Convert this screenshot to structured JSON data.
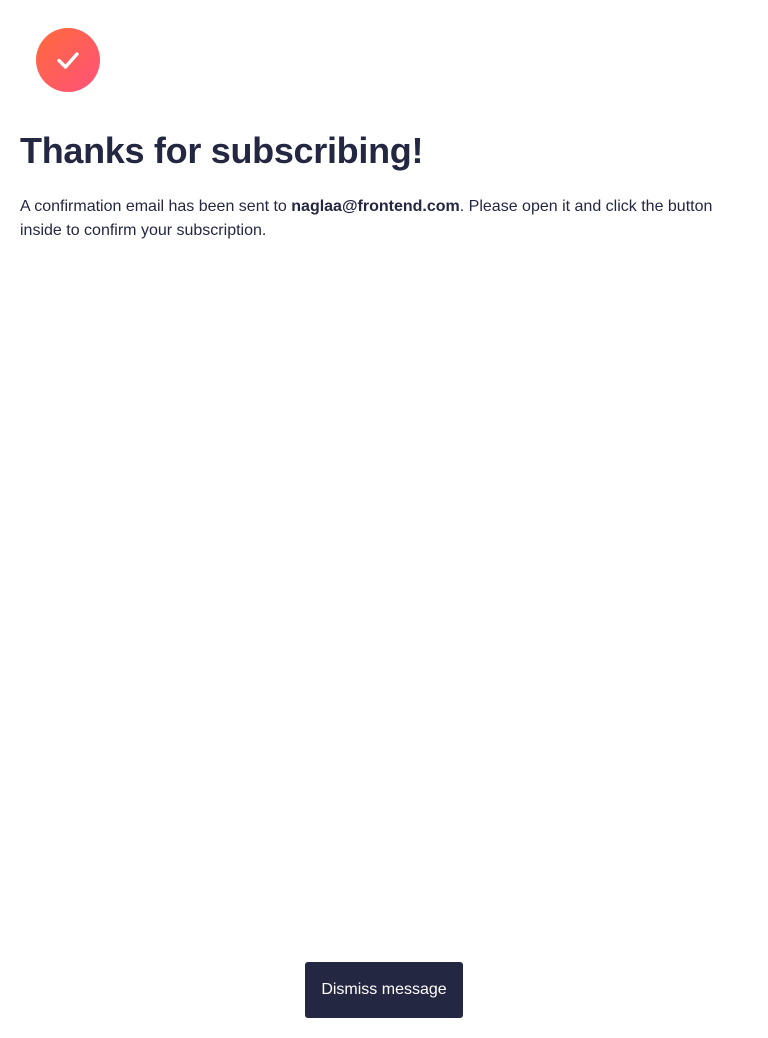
{
  "icon": {
    "name": "checkmark-icon",
    "gradient_start": "#ff6a3a",
    "gradient_end": "#ff527b",
    "check_color": "#ffffff"
  },
  "title": "Thanks for subscribing!",
  "message": {
    "prefix": "A confirmation email has been sent to ",
    "email": "naglaa@frontend.com",
    "suffix": ". Please open it and click the button inside to confirm your subscription."
  },
  "dismiss_button": {
    "label": "Dismiss message",
    "background": "#242742"
  },
  "text_color": "#242742"
}
